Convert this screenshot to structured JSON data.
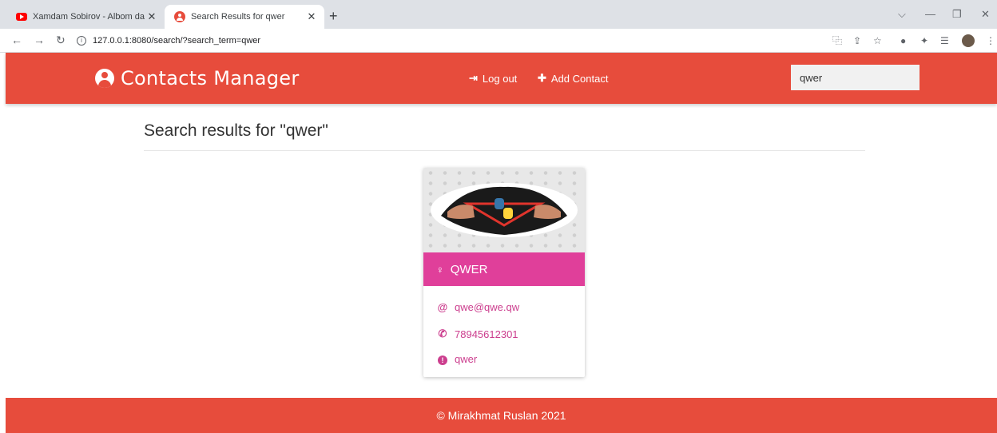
{
  "browser": {
    "tabs": [
      {
        "title": "Xamdam Sobirov - Albom dastur",
        "active": false
      },
      {
        "title": "Search Results for qwer",
        "active": true
      }
    ],
    "url": "127.0.0.1:8080/search/?search_term=qwer"
  },
  "header": {
    "brand": "Contacts Manager",
    "nav": {
      "logout": "Log out",
      "add_contact": "Add Contact"
    },
    "search_value": "qwer"
  },
  "main": {
    "results_title": "Search results for \"qwer\"",
    "contacts": [
      {
        "name": "QWER",
        "email": "qwe@qwe.qw",
        "phone": "78945612301",
        "info": "qwer"
      }
    ]
  },
  "footer": {
    "copyright": "© Mirakhmat Ruslan 2021"
  },
  "colors": {
    "header": "#e74c3c",
    "card_head": "#e03f9a",
    "card_text": "#cc3e8e"
  }
}
